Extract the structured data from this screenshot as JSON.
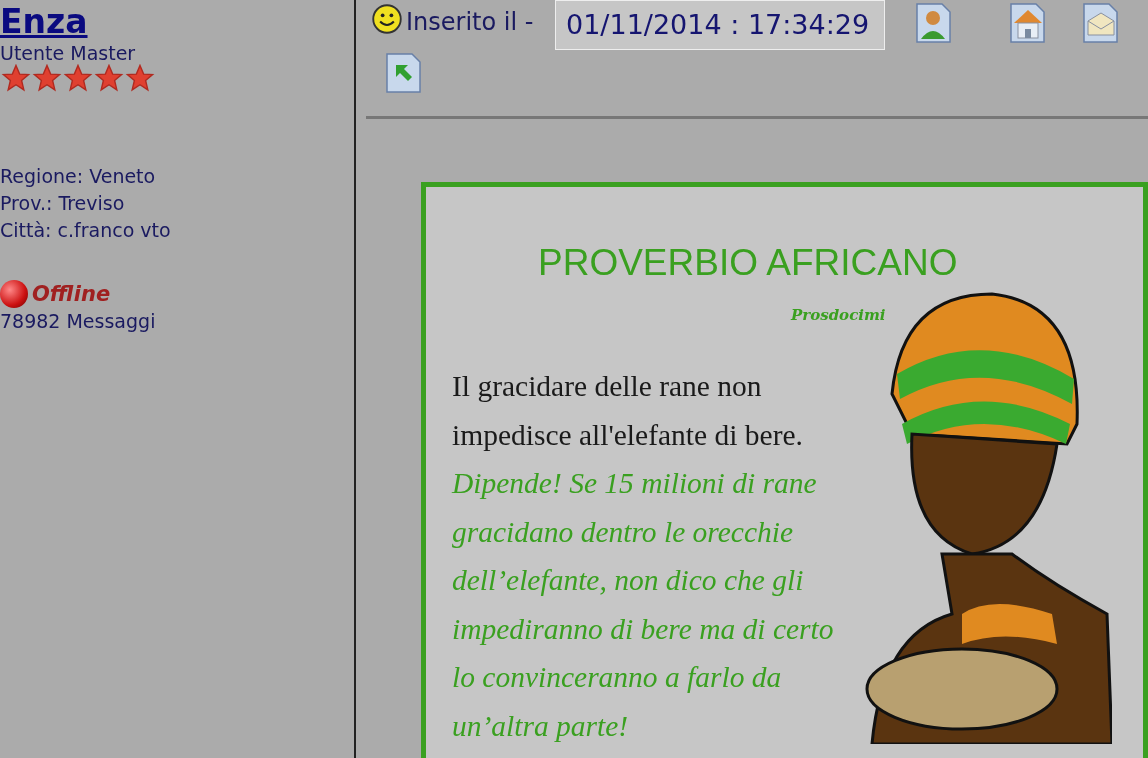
{
  "author": {
    "name": "Enza",
    "rank": "Utente Master",
    "stars": 5,
    "details": [
      "Regione: Veneto",
      "Prov.: Treviso",
      "Città: c.franco vto"
    ],
    "online": false,
    "status": "Offline",
    "posts": "78982 Messaggi"
  },
  "post": {
    "posted_label": "Inserito il -",
    "date": "01/11/2014 : 17:34:29",
    "toolbar": [
      {
        "kind": "profile"
      },
      {
        "kind": "home"
      },
      {
        "kind": "email"
      },
      {
        "kind": "reply"
      }
    ],
    "card": {
      "title": "PROVERBIO AFRICANO",
      "author": "Prosdocimi",
      "proverb": "Il gracidare delle rane non impedisce all'elefante di bere.",
      "comment": "Dipende! Se 15 milioni di rane gracidano dentro le orecchie dell’elefante, non dico che gli impediranno di bere ma di certo lo convinceranno a farlo da un’altra parte!"
    }
  }
}
